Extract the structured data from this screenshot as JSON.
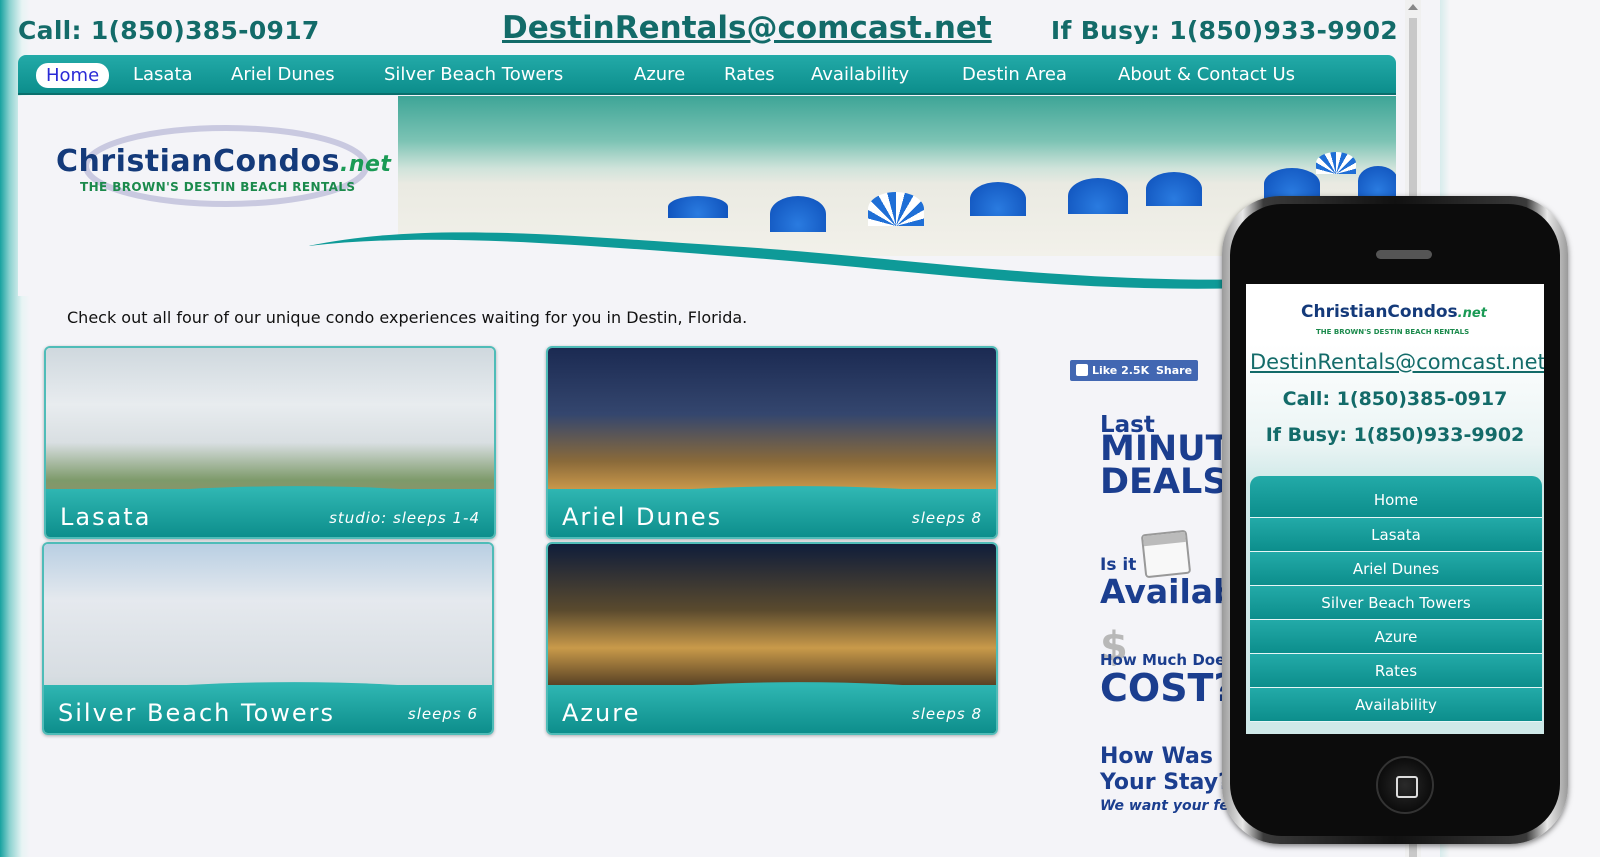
{
  "header": {
    "call": "Call: 1(850)385-0917",
    "email": "DestinRentals@comcast.net",
    "busy": "If Busy: 1(850)933-9902"
  },
  "nav": [
    {
      "label": "Home",
      "active": true
    },
    {
      "label": "Lasata"
    },
    {
      "label": "Ariel Dunes"
    },
    {
      "label": "Silver Beach Towers"
    },
    {
      "label": "Azure"
    },
    {
      "label": "Rates"
    },
    {
      "label": "Availability"
    },
    {
      "label": "Destin Area"
    },
    {
      "label": "About & Contact Us"
    }
  ],
  "logo": {
    "main": "ChristianCondos",
    "net": ".net",
    "sub": "THE BROWN'S DESTIN BEACH RENTALS"
  },
  "intro": "Check out all four of our unique condo experiences waiting for you in Destin, Florida.",
  "cards": [
    {
      "name": "Lasata",
      "sleeps": "studio: sleeps 1-4"
    },
    {
      "name": "Ariel Dunes",
      "sleeps": "sleeps 8"
    },
    {
      "name": "Silver Beach Towers",
      "sleeps": "sleeps 6"
    },
    {
      "name": "Azure",
      "sleeps": "sleeps 8"
    }
  ],
  "facebook": {
    "like": "Like 2.5K",
    "share": "Share"
  },
  "sidebar": {
    "last": "Last",
    "minute": "MINUTE",
    "deals": "DEALS",
    "isit": "Is it",
    "available": "Available",
    "howmuch": "How Much Does",
    "cost": "COST?",
    "howwas_1": "How Was",
    "howwas_2": "Your Stay?",
    "feedback": "We want your feedback"
  },
  "mobile": {
    "email": "DestinRentals@comcast.net",
    "call": "Call: 1(850)385-0917",
    "busy": "If Busy: 1(850)933-9902",
    "nav": [
      "Home",
      "Lasata",
      "Ariel Dunes",
      "Silver Beach Towers",
      "Azure",
      "Rates",
      "Availability"
    ]
  },
  "colors": {
    "teal": "#0c8e8c",
    "dark_teal_text": "#136b69",
    "navy": "#1b3e8f",
    "facebook_blue": "#4267b2"
  }
}
